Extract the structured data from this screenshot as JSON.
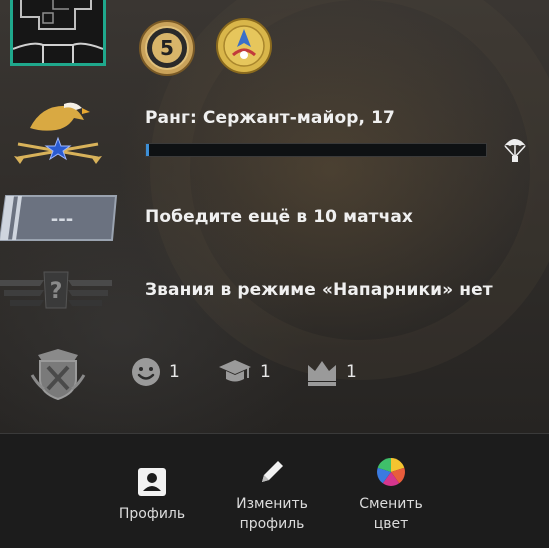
{
  "rank": {
    "label": "Ранг: Сержант-майор, 17",
    "progress_fraction": 0.01,
    "icon": "eagle-rank-icon"
  },
  "competitive": {
    "label": "Победите ещё в 10 матчах",
    "badge_text": "---",
    "icon": "skill-group-unranked-icon"
  },
  "wingman": {
    "label": "Звания в режиме «Напарники» нет",
    "badge_text": "?",
    "icon": "wingman-unranked-icon"
  },
  "medals": [
    {
      "name": "five-year-coin-icon",
      "text": "5"
    },
    {
      "name": "operation-coin-icon"
    }
  ],
  "stats": {
    "friendly": "1",
    "teacher": "1",
    "leader": "1"
  },
  "bottom": {
    "profile": "Профиль",
    "edit_profile": "Изменить\nпрофиль",
    "change_color": "Сменить\nцвет"
  },
  "colors": {
    "accent_teal": "#1fa88c",
    "progress_blue": "#3d8fd6",
    "bar_bg": "#1c1c1c"
  }
}
